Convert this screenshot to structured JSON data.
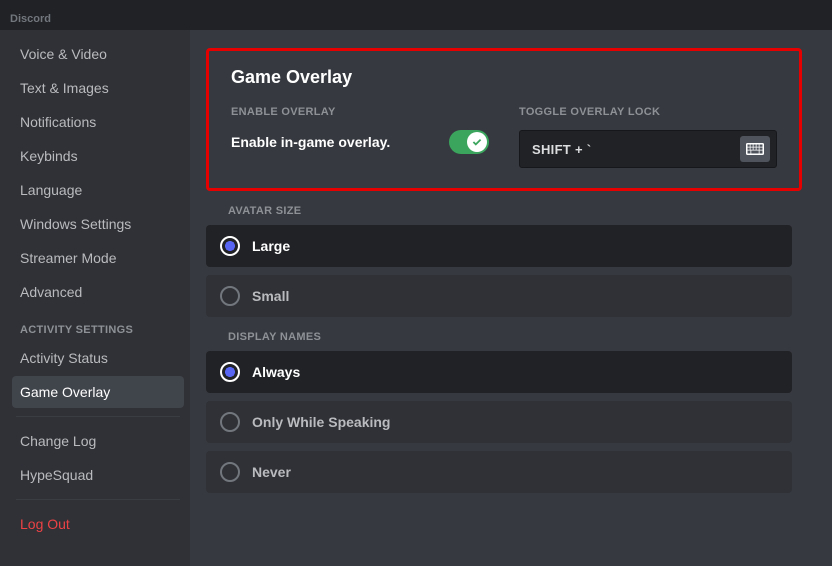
{
  "titlebar": {
    "app_name": "Discord"
  },
  "sidebar": {
    "items_top": [
      "Voice & Video",
      "Text & Images",
      "Notifications",
      "Keybinds",
      "Language",
      "Windows Settings",
      "Streamer Mode",
      "Advanced"
    ],
    "activity_heading": "ACTIVITY SETTINGS",
    "activity_items": [
      "Activity Status",
      "Game Overlay"
    ],
    "activity_selected_index": 1,
    "misc_items": [
      "Change Log",
      "HypeSquad"
    ],
    "logout": "Log Out"
  },
  "overlay": {
    "title": "Game Overlay",
    "enable_heading": "ENABLE OVERLAY",
    "enable_text": "Enable in-game overlay.",
    "enable_state": true,
    "lock_heading": "TOGGLE OVERLAY LOCK",
    "lock_value": "SHIFT + `"
  },
  "avatar_size": {
    "heading": "AVATAR SIZE",
    "options": [
      "Large",
      "Small"
    ],
    "selected_index": 0
  },
  "display_names": {
    "heading": "DISPLAY NAMES",
    "options": [
      "Always",
      "Only While Speaking",
      "Never"
    ],
    "selected_index": 0
  }
}
